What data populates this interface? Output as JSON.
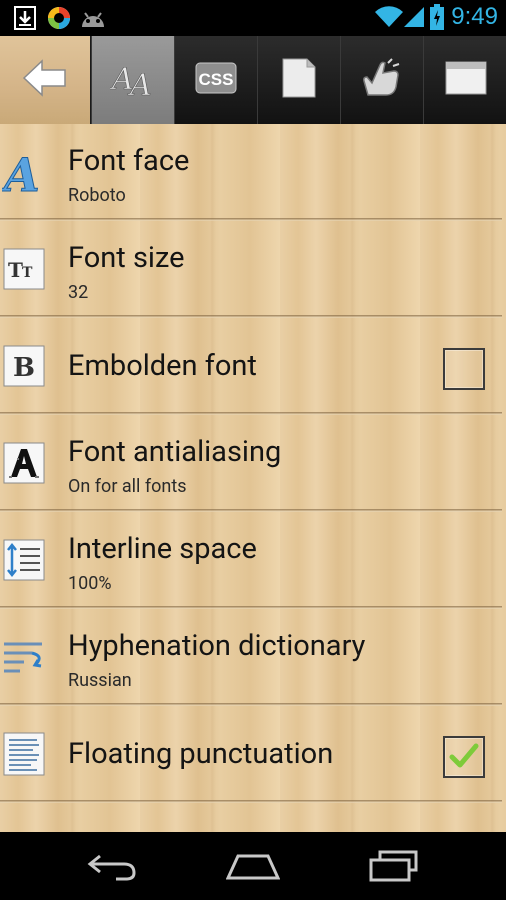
{
  "status_bar": {
    "time": "9:49",
    "icons": [
      "download-icon",
      "app-notification-icon",
      "android-icon",
      "wifi-icon",
      "signal-icon",
      "battery-charging-icon"
    ]
  },
  "toolbar": {
    "back_icon": "back-arrow-icon",
    "tabs": [
      {
        "name": "fonts-tab",
        "icon": "font-aa-icon",
        "active": true
      },
      {
        "name": "css-tab",
        "icon": "css-icon",
        "label": "CSS",
        "active": false
      },
      {
        "name": "page-tab",
        "icon": "page-icon",
        "active": false
      },
      {
        "name": "controls-tab",
        "icon": "tap-hand-icon",
        "active": false
      },
      {
        "name": "window-tab",
        "icon": "window-icon",
        "active": false
      }
    ]
  },
  "settings": [
    {
      "title": "Font face",
      "subtitle": "Roboto",
      "icon": "font-face-icon"
    },
    {
      "title": "Font size",
      "subtitle": "32",
      "icon": "font-size-icon"
    },
    {
      "title": "Embolden font",
      "icon": "bold-icon",
      "checkbox": true,
      "checked": false
    },
    {
      "title": "Font antialiasing",
      "subtitle": "On for all fonts",
      "icon": "antialiasing-icon"
    },
    {
      "title": "Interline space",
      "subtitle": "100%",
      "icon": "line-spacing-icon"
    },
    {
      "title": "Hyphenation dictionary",
      "subtitle": "Russian",
      "icon": "hyphenation-icon"
    },
    {
      "title": "Floating punctuation",
      "icon": "document-text-icon",
      "checkbox": true,
      "checked": true
    }
  ],
  "navbar": {
    "buttons": [
      "back-nav-icon",
      "home-nav-icon",
      "recent-apps-icon"
    ]
  },
  "colors": {
    "accent": "#33b5e5",
    "check": "#7ecb3a",
    "wood": "#e5c99c"
  }
}
